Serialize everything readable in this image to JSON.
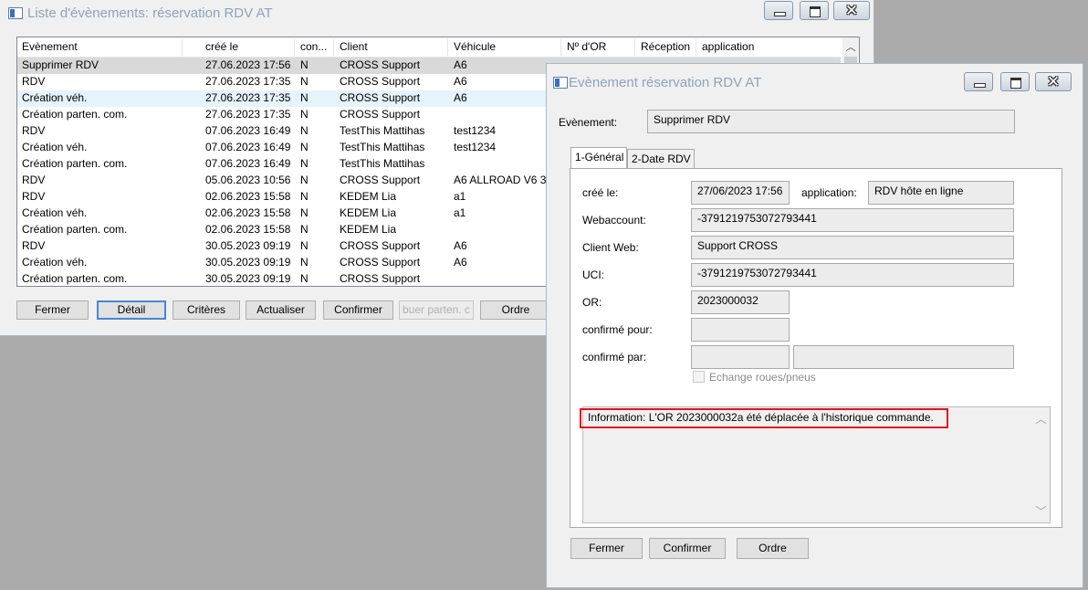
{
  "list_window": {
    "title": "Liste d'évènements: réservation RDV AT",
    "columns": [
      "Evènement",
      "créé le",
      "con...",
      "Client",
      "Véhicule",
      "Nº d'OR",
      "Réception",
      "application"
    ],
    "rows": [
      {
        "event": "Supprimer RDV",
        "created": "27.06.2023 17:56",
        "con": "N",
        "client": "CROSS Support",
        "vehicle": "A6"
      },
      {
        "event": "RDV",
        "created": "27.06.2023 17:35",
        "con": "N",
        "client": "CROSS Support",
        "vehicle": "A6"
      },
      {
        "event": "Création véh.",
        "created": "27.06.2023 17:35",
        "con": "N",
        "client": "CROSS Support",
        "vehicle": "A6"
      },
      {
        "event": "Création parten. com.",
        "created": "27.06.2023 17:35",
        "con": "N",
        "client": "CROSS Support",
        "vehicle": ""
      },
      {
        "event": "RDV",
        "created": "07.06.2023 16:49",
        "con": "N",
        "client": "TestThis Mattihas",
        "vehicle": "test1234"
      },
      {
        "event": "Création véh.",
        "created": "07.06.2023 16:49",
        "con": "N",
        "client": "TestThis Mattihas",
        "vehicle": "test1234"
      },
      {
        "event": "Création parten. com.",
        "created": "07.06.2023 16:49",
        "con": "N",
        "client": "TestThis Mattihas",
        "vehicle": ""
      },
      {
        "event": "RDV",
        "created": "05.06.2023 10:56",
        "con": "N",
        "client": "CROSS Support",
        "vehicle": "A6 ALLROAD V6 3..."
      },
      {
        "event": "RDV",
        "created": "02.06.2023 15:58",
        "con": "N",
        "client": "KEDEM Lia",
        "vehicle": "a1"
      },
      {
        "event": "Création véh.",
        "created": "02.06.2023 15:58",
        "con": "N",
        "client": "KEDEM Lia",
        "vehicle": "a1"
      },
      {
        "event": "Création parten. com.",
        "created": "02.06.2023 15:58",
        "con": "N",
        "client": "KEDEM Lia",
        "vehicle": ""
      },
      {
        "event": "RDV",
        "created": "30.05.2023 09:19",
        "con": "N",
        "client": "CROSS Support",
        "vehicle": "A6"
      },
      {
        "event": "Création véh.",
        "created": "30.05.2023 09:19",
        "con": "N",
        "client": "CROSS Support",
        "vehicle": "A6"
      },
      {
        "event": "Création parten. com.",
        "created": "30.05.2023 09:19",
        "con": "N",
        "client": "CROSS Support",
        "vehicle": ""
      }
    ],
    "buttons": {
      "fermer": "Fermer",
      "detail": "Détail",
      "criteres": "Critères",
      "actualiser": "Actualiser",
      "confirmer": "Confirmer",
      "partner": "buer parten. c",
      "ordre": "Ordre"
    }
  },
  "detail_window": {
    "title": "Evènement réservation RDV AT",
    "event_label": "Evènement:",
    "event_value": "Supprimer RDV",
    "tabs": [
      "1-Général",
      "2-Date RDV"
    ],
    "fields": {
      "cree_le_label": "créé le:",
      "cree_le_value": "27/06/2023 17:56",
      "application_label": "application:",
      "application_value": "RDV hôte en ligne",
      "webaccount_label": "Webaccount:",
      "webaccount_value": "-3791219753072793441",
      "client_web_label": "Client Web:",
      "client_web_value": "Support CROSS",
      "uci_label": "UCI:",
      "uci_value": "-3791219753072793441",
      "or_label": "OR:",
      "or_value": "2023000032",
      "confirme_pour_label": "confirmé pour:",
      "confirme_pour_value": "",
      "confirme_par_label": "confirmé par:",
      "confirme_par_value1": "",
      "confirme_par_value2": "",
      "echange_label": "Echange roues/pneus"
    },
    "information": "Information:  L'OR 2023000032a été déplacée à l'historique commande.",
    "buttons": {
      "fermer": "Fermer",
      "confirmer": "Confirmer",
      "ordre": "Ordre"
    }
  },
  "colors": {
    "desktop": "#ababab",
    "window": "#f0f0f0",
    "selected_row": "#d9d9d9",
    "highlight_border": "#e0141e",
    "default_button_border": "#4587d6"
  }
}
